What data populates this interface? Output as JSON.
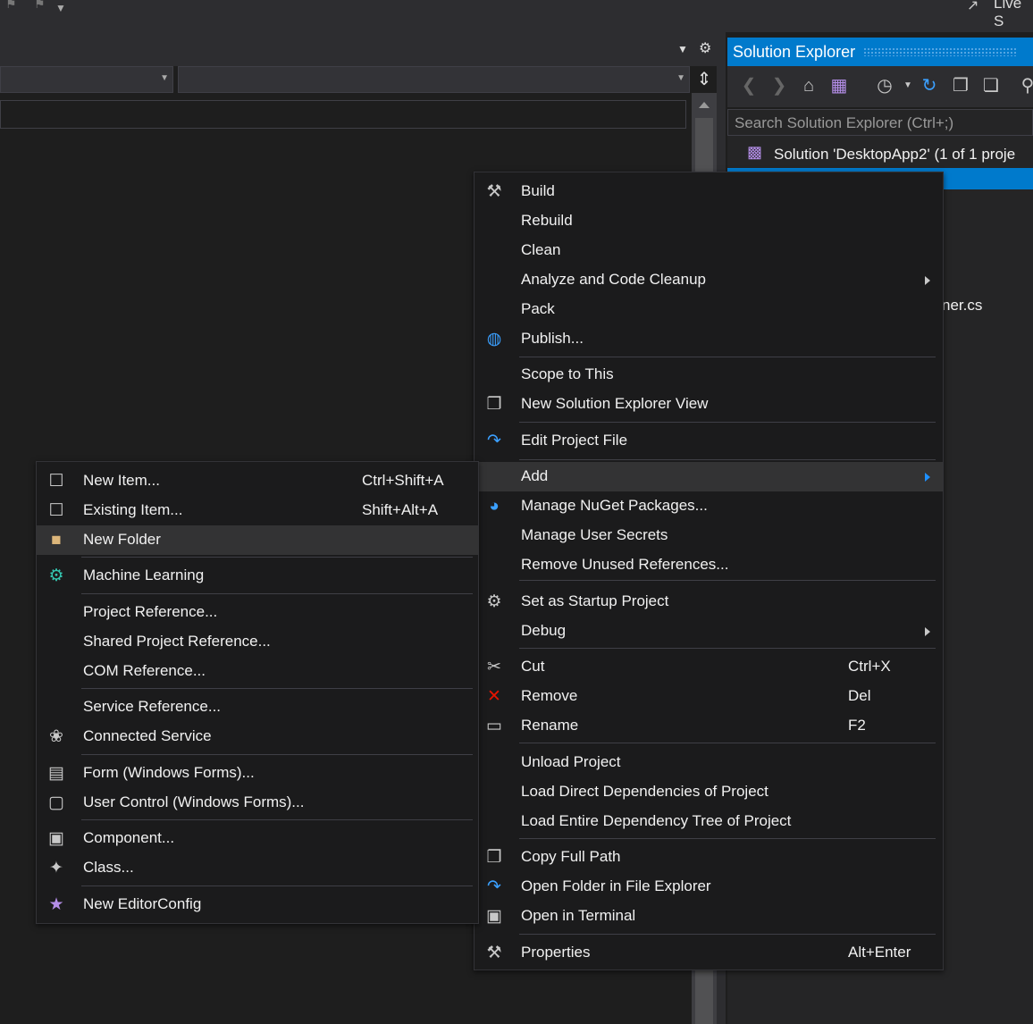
{
  "top_right_label": "Live S",
  "solution_explorer": {
    "title": "Solution Explorer",
    "search_placeholder": "Search Solution Explorer (Ctrl+;)",
    "solution_row": "Solution 'DesktopApp2' (1 of 1 proje",
    "partial_file": "ner.cs"
  },
  "main_menu": {
    "items": [
      {
        "label": "Build",
        "icon": "build-icon"
      },
      {
        "label": "Rebuild"
      },
      {
        "label": "Clean"
      },
      {
        "label": "Analyze and Code Cleanup",
        "submenu": true
      },
      {
        "label": "Pack"
      },
      {
        "label": "Publish...",
        "icon": "globe-icon"
      },
      {
        "label": "Scope to This"
      },
      {
        "label": "New Solution Explorer View",
        "icon": "new-view-icon"
      },
      {
        "label": "Edit Project File",
        "icon": "redo-arrow-icon"
      },
      {
        "label": "Add",
        "submenu": true
      },
      {
        "label": "Manage NuGet Packages...",
        "icon": "nuget-icon"
      },
      {
        "label": "Manage User Secrets"
      },
      {
        "label": "Remove Unused References..."
      },
      {
        "label": "Set as Startup Project",
        "icon": "gear-icon"
      },
      {
        "label": "Debug",
        "submenu": true
      },
      {
        "label": "Cut",
        "shortcut": "Ctrl+X",
        "icon": "scissors-icon"
      },
      {
        "label": "Remove",
        "shortcut": "Del",
        "icon": "red-x-icon"
      },
      {
        "label": "Rename",
        "shortcut": "F2",
        "icon": "rename-icon"
      },
      {
        "label": "Unload Project"
      },
      {
        "label": "Load Direct Dependencies of Project"
      },
      {
        "label": "Load Entire Dependency Tree of Project"
      },
      {
        "label": "Copy Full Path",
        "icon": "copy-icon"
      },
      {
        "label": "Open Folder in File Explorer",
        "icon": "redo-arrow-icon"
      },
      {
        "label": "Open in Terminal",
        "icon": "terminal-icon"
      },
      {
        "label": "Properties",
        "shortcut": "Alt+Enter",
        "icon": "wrench-icon"
      }
    ]
  },
  "add_menu": {
    "items": [
      {
        "label": "New Item...",
        "shortcut": "Ctrl+Shift+A",
        "icon": "new-item-icon"
      },
      {
        "label": "Existing Item...",
        "shortcut": "Shift+Alt+A",
        "icon": "existing-item-icon"
      },
      {
        "label": "New Folder",
        "icon": "new-folder-icon"
      },
      {
        "label": "Machine Learning",
        "icon": "ml-gear-icon"
      },
      {
        "label": "Project Reference..."
      },
      {
        "label": "Shared Project Reference..."
      },
      {
        "label": "COM Reference..."
      },
      {
        "label": "Service Reference..."
      },
      {
        "label": "Connected Service",
        "icon": "connected-service-icon"
      },
      {
        "label": "Form (Windows Forms)...",
        "icon": "form-icon"
      },
      {
        "label": "User Control (Windows Forms)...",
        "icon": "user-control-icon"
      },
      {
        "label": "Component...",
        "icon": "component-icon"
      },
      {
        "label": "Class...",
        "icon": "class-icon"
      },
      {
        "label": "New EditorConfig",
        "icon": "editorconfig-icon"
      }
    ]
  },
  "colors": {
    "accent": "#007acc",
    "menu_bg": "#1b1b1c",
    "highlight": "#333334",
    "remove_red": "#e51400"
  }
}
